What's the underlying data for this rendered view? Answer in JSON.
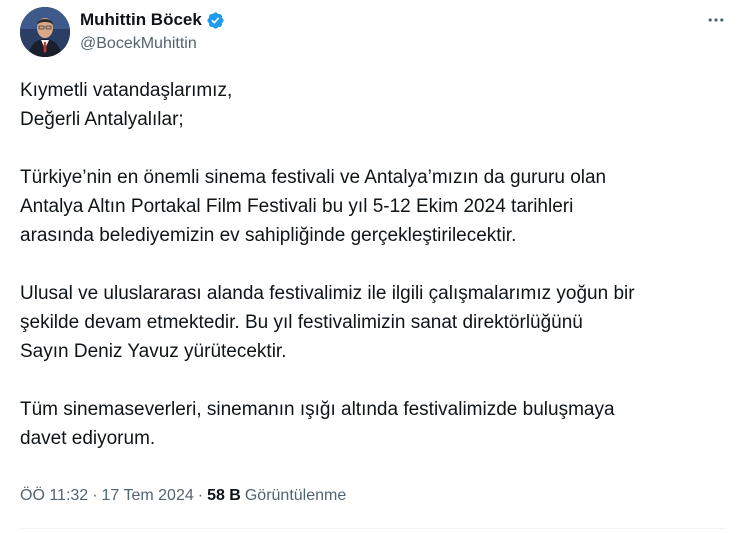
{
  "author": {
    "display_name": "Muhittin Böcek",
    "handle": "@BocekMuhittin",
    "verified_icon": "verified-badge-icon",
    "verified_color": "#1d9bf0"
  },
  "more_icon": "more-options-icon",
  "tweet": {
    "lines": [
      "Kıymetli vatandaşlarımız,",
      "Değerli Antalyalılar;",
      "",
      "Türkiye’nin en önemli sinema festivali ve Antalya’mızın da gururu olan",
      "Antalya Altın Portakal Film Festivali bu yıl 5-12 Ekim 2024 tarihleri",
      "arasında belediyemizin ev sahipliğinde gerçekleştirilecektir.",
      "",
      "Ulusal ve uluslararası alanda festivalimiz ile ilgili çalışmalarımız yoğun bir",
      "şekilde devam etmektedir. Bu yıl festivalimizin sanat direktörlüğünü",
      "Sayın Deniz Yavuz yürütecektir.",
      "",
      "Tüm sinemaseverleri, sinemanın ışığı altında festivalimizde buluşmaya",
      "davet ediyorum."
    ]
  },
  "meta": {
    "time": "ÖÖ 11:32",
    "separator": "·",
    "date": "17 Tem 2024",
    "views_count": "58 B",
    "views_label": "Görüntülenme"
  }
}
